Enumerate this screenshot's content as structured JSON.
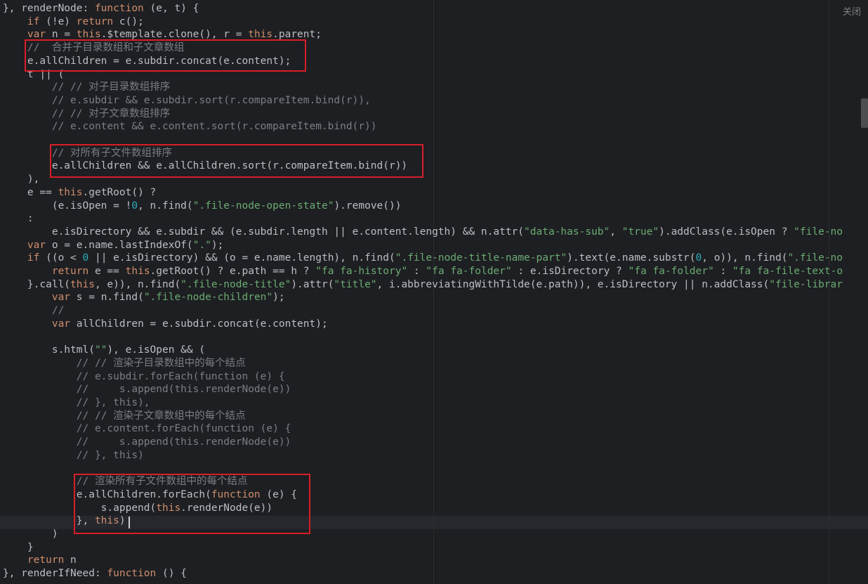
{
  "window": {
    "close_label": "关闭"
  },
  "colors": {
    "background": "#1e1f22",
    "default": "#bcbec4",
    "keyword": "#cf8e6d",
    "string": "#6aab73",
    "comment": "#7a7e85",
    "number": "#2aacb8",
    "function": "#56a8f5",
    "this": "#cf8e6d",
    "operator": "#bcbec4",
    "punct": "#bcbec4",
    "annotation_border": "#d81e28"
  },
  "code_lines": [
    [
      [
        "default",
        "}, renderNode: "
      ],
      [
        "keyword",
        "function"
      ],
      [
        "default",
        " (e, t) {"
      ]
    ],
    [
      [
        "default",
        "    "
      ],
      [
        "keyword",
        "if"
      ],
      [
        "default",
        " (!e) "
      ],
      [
        "keyword",
        "return"
      ],
      [
        "default",
        " c();"
      ]
    ],
    [
      [
        "default",
        "    "
      ],
      [
        "keyword",
        "var"
      ],
      [
        "default",
        " n = "
      ],
      [
        "keyword",
        "this"
      ],
      [
        "default",
        ".$template.clone(), r = "
      ],
      [
        "keyword",
        "this"
      ],
      [
        "default",
        ".parent;"
      ]
    ],
    [
      [
        "default",
        "    "
      ],
      [
        "comment",
        "//  合并子目录数组和子文章数组"
      ]
    ],
    [
      [
        "default",
        "    e.allChildren = e.subdir.concat(e.content);"
      ]
    ],
    [
      [
        "default",
        "    t || ("
      ]
    ],
    [
      [
        "default",
        "        "
      ],
      [
        "comment",
        "// // 对子目录数组排序"
      ]
    ],
    [
      [
        "default",
        "        "
      ],
      [
        "comment",
        "// e.subdir && e.subdir.sort(r.compareItem.bind(r)),"
      ]
    ],
    [
      [
        "default",
        "        "
      ],
      [
        "comment",
        "// // 对子文章数组排序"
      ]
    ],
    [
      [
        "default",
        "        "
      ],
      [
        "comment",
        "// e.content && e.content.sort(r.compareItem.bind(r))"
      ]
    ],
    [
      [
        "default",
        ""
      ]
    ],
    [
      [
        "default",
        "        "
      ],
      [
        "comment",
        "// 对所有子文件数组排序"
      ]
    ],
    [
      [
        "default",
        "        e.allChildren && e.allChildren.sort(r.compareItem.bind(r))"
      ]
    ],
    [
      [
        "default",
        "    ),"
      ]
    ],
    [
      [
        "default",
        "    e == "
      ],
      [
        "keyword",
        "this"
      ],
      [
        "default",
        ".getRoot() ?"
      ]
    ],
    [
      [
        "default",
        "        (e.isOpen = !"
      ],
      [
        "number",
        "0"
      ],
      [
        "default",
        ", n.find("
      ],
      [
        "string",
        "\".file-node-open-state\""
      ],
      [
        "default",
        ").remove())"
      ]
    ],
    [
      [
        "default",
        "    :"
      ]
    ],
    [
      [
        "default",
        "        e.isDirectory && e.subdir && (e.subdir.length || e.content.length) && n.attr("
      ],
      [
        "string",
        "\"data-has-sub\""
      ],
      [
        "default",
        ", "
      ],
      [
        "string",
        "\"true\""
      ],
      [
        "default",
        ").addClass(e.isOpen ? "
      ],
      [
        "string",
        "\"file-no"
      ]
    ],
    [
      [
        "default",
        "    "
      ],
      [
        "keyword",
        "var"
      ],
      [
        "default",
        " o = e.name.lastIndexOf("
      ],
      [
        "string",
        "\".\""
      ],
      [
        "default",
        ");"
      ]
    ],
    [
      [
        "default",
        "    "
      ],
      [
        "keyword",
        "if"
      ],
      [
        "default",
        " ((o < "
      ],
      [
        "number",
        "0"
      ],
      [
        "default",
        " || e.isDirectory) && (o = e.name.length), n.find("
      ],
      [
        "string",
        "\".file-node-title-name-part\""
      ],
      [
        "default",
        ").text(e.name.substr("
      ],
      [
        "number",
        "0"
      ],
      [
        "default",
        ", o)), n.find("
      ],
      [
        "string",
        "\".file-no"
      ]
    ],
    [
      [
        "default",
        "        "
      ],
      [
        "keyword",
        "return"
      ],
      [
        "default",
        " e == "
      ],
      [
        "keyword",
        "this"
      ],
      [
        "default",
        ".getRoot() ? e.path == h ? "
      ],
      [
        "string",
        "\"fa fa-history\""
      ],
      [
        "default",
        " : "
      ],
      [
        "string",
        "\"fa fa-folder\""
      ],
      [
        "default",
        " : e.isDirectory ? "
      ],
      [
        "string",
        "\"fa fa-folder\""
      ],
      [
        "default",
        " : "
      ],
      [
        "string",
        "\"fa fa-file-text-o"
      ]
    ],
    [
      [
        "default",
        "    }.call("
      ],
      [
        "keyword",
        "this"
      ],
      [
        "default",
        ", e)), n.find("
      ],
      [
        "string",
        "\".file-node-title\""
      ],
      [
        "default",
        ").attr("
      ],
      [
        "string",
        "\"title\""
      ],
      [
        "default",
        ", i.abbreviatingWithTilde(e.path)), e.isDirectory || n.addClass("
      ],
      [
        "string",
        "\"file-librar"
      ]
    ],
    [
      [
        "default",
        "        "
      ],
      [
        "keyword",
        "var"
      ],
      [
        "default",
        " s = n.find("
      ],
      [
        "string",
        "\".file-node-children\""
      ],
      [
        "default",
        ");"
      ]
    ],
    [
      [
        "default",
        "        "
      ],
      [
        "comment",
        "//"
      ]
    ],
    [
      [
        "default",
        "        "
      ],
      [
        "keyword",
        "var"
      ],
      [
        "default",
        " allChildren = e.subdir.concat(e.content);"
      ]
    ],
    [
      [
        "default",
        ""
      ]
    ],
    [
      [
        "default",
        "        s.html("
      ],
      [
        "string",
        "\"\""
      ],
      [
        "default",
        "), e.isOpen && ("
      ]
    ],
    [
      [
        "default",
        "            "
      ],
      [
        "comment",
        "// // 渲染子目录数组中的每个结点"
      ]
    ],
    [
      [
        "default",
        "            "
      ],
      [
        "comment",
        "// e.subdir.forEach(function (e) {"
      ]
    ],
    [
      [
        "default",
        "            "
      ],
      [
        "comment",
        "//     s.append(this.renderNode(e))"
      ]
    ],
    [
      [
        "default",
        "            "
      ],
      [
        "comment",
        "// }, this),"
      ]
    ],
    [
      [
        "default",
        "            "
      ],
      [
        "comment",
        "// // 渲染子文章数组中的每个结点"
      ]
    ],
    [
      [
        "default",
        "            "
      ],
      [
        "comment",
        "// e.content.forEach(function (e) {"
      ]
    ],
    [
      [
        "default",
        "            "
      ],
      [
        "comment",
        "//     s.append(this.renderNode(e))"
      ]
    ],
    [
      [
        "default",
        "            "
      ],
      [
        "comment",
        "// }, this)"
      ]
    ],
    [
      [
        "default",
        ""
      ]
    ],
    [
      [
        "default",
        "            "
      ],
      [
        "comment",
        "// 渲染所有子文件数组中的每个结点"
      ]
    ],
    [
      [
        "default",
        "            e.allChildren.forEach("
      ],
      [
        "keyword",
        "function"
      ],
      [
        "default",
        " (e) {"
      ]
    ],
    [
      [
        "default",
        "                s.append("
      ],
      [
        "keyword",
        "this"
      ],
      [
        "default",
        ".renderNode(e))"
      ]
    ],
    [
      [
        "default",
        "            }, "
      ],
      [
        "keyword",
        "this"
      ],
      [
        "default",
        ")"
      ]
    ],
    [
      [
        "default",
        "        )"
      ]
    ],
    [
      [
        "default",
        "    }"
      ]
    ],
    [
      [
        "default",
        "    "
      ],
      [
        "keyword",
        "return"
      ],
      [
        "default",
        " n"
      ]
    ],
    [
      [
        "default",
        "}, renderIfNeed: "
      ],
      [
        "keyword",
        "function"
      ],
      [
        "default",
        " () {"
      ]
    ]
  ]
}
